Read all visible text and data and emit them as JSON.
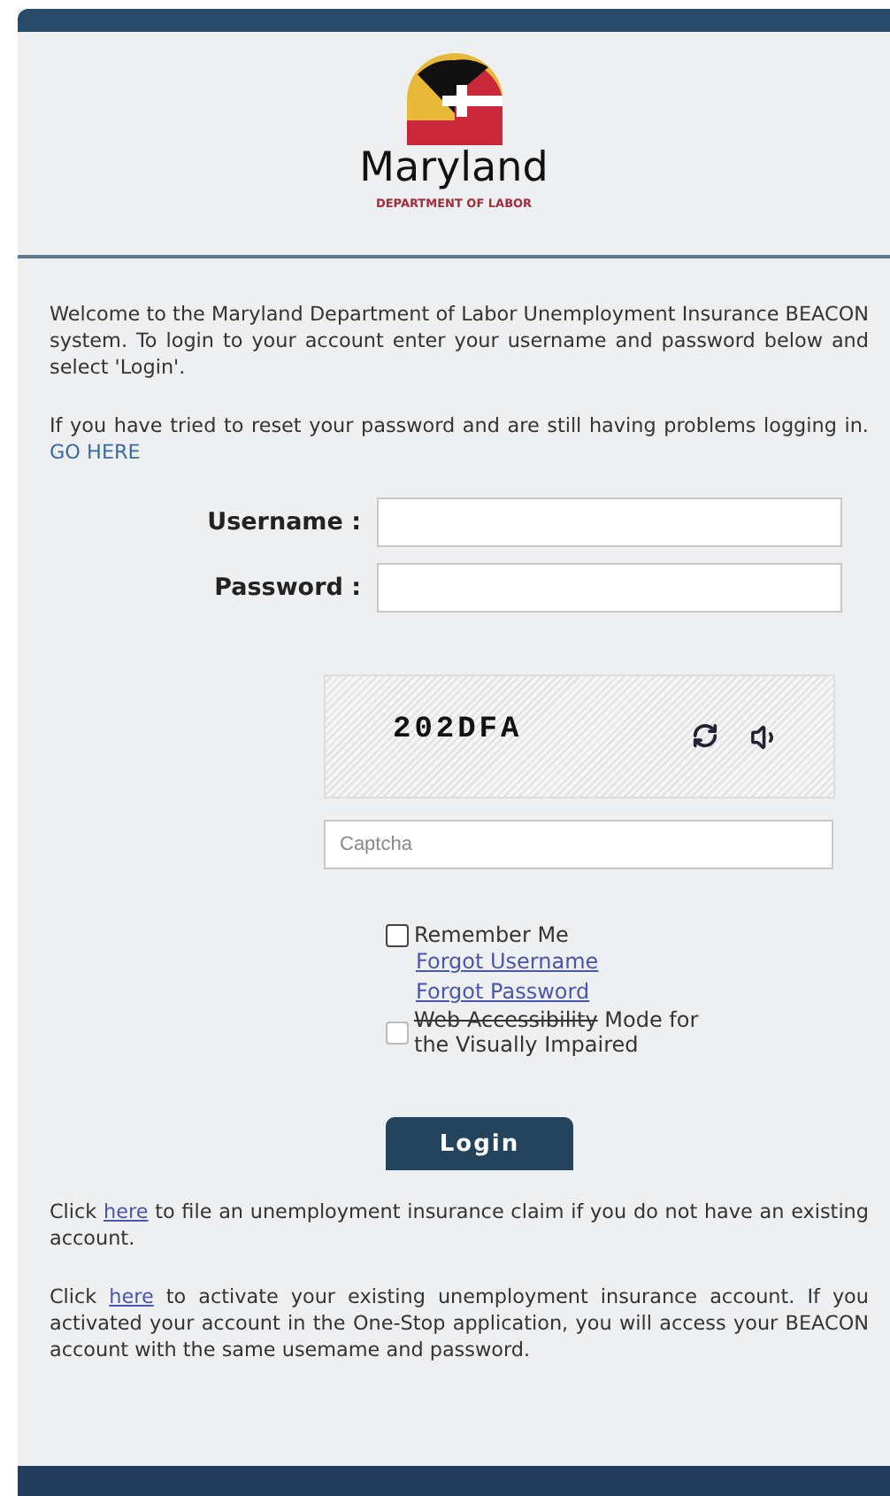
{
  "logo": {
    "name": "Maryland",
    "subtitle": "DEPARTMENT OF LABOR"
  },
  "intro": "Welcome to the Maryland Department of Labor Unemployment Insurance BEACON system. To login to your account enter your username and password below and select 'Login'.",
  "reset_notice": {
    "before": "If you have tried to reset your password and are still having problems logging in. ",
    "link": "GO HERE"
  },
  "form": {
    "fields": [
      {
        "label": "Username :"
      },
      {
        "label": "Password :"
      }
    ],
    "captcha": {
      "code": "202DFA",
      "placeholder": "Captcha"
    },
    "remember_me": {
      "label": "Remember Me",
      "checked": false
    },
    "links": [
      "Forgot Username",
      "Forgot Password"
    ],
    "accessibility": {
      "struck": "Web Accessibility",
      "rest": " Mode for the Visually Impaired",
      "checked": false
    },
    "submit": "Login"
  },
  "footer_notes": [
    {
      "before": "Click ",
      "link": "here",
      "after": " to file an unemployment insurance claim if you do not have an existing account."
    },
    {
      "before": "Click ",
      "link": "here",
      "after": " to activate your existing unemployment insurance account. If you activated your account in the One-Stop application, you will access your BEACON account with the same usemame and password."
    }
  ]
}
